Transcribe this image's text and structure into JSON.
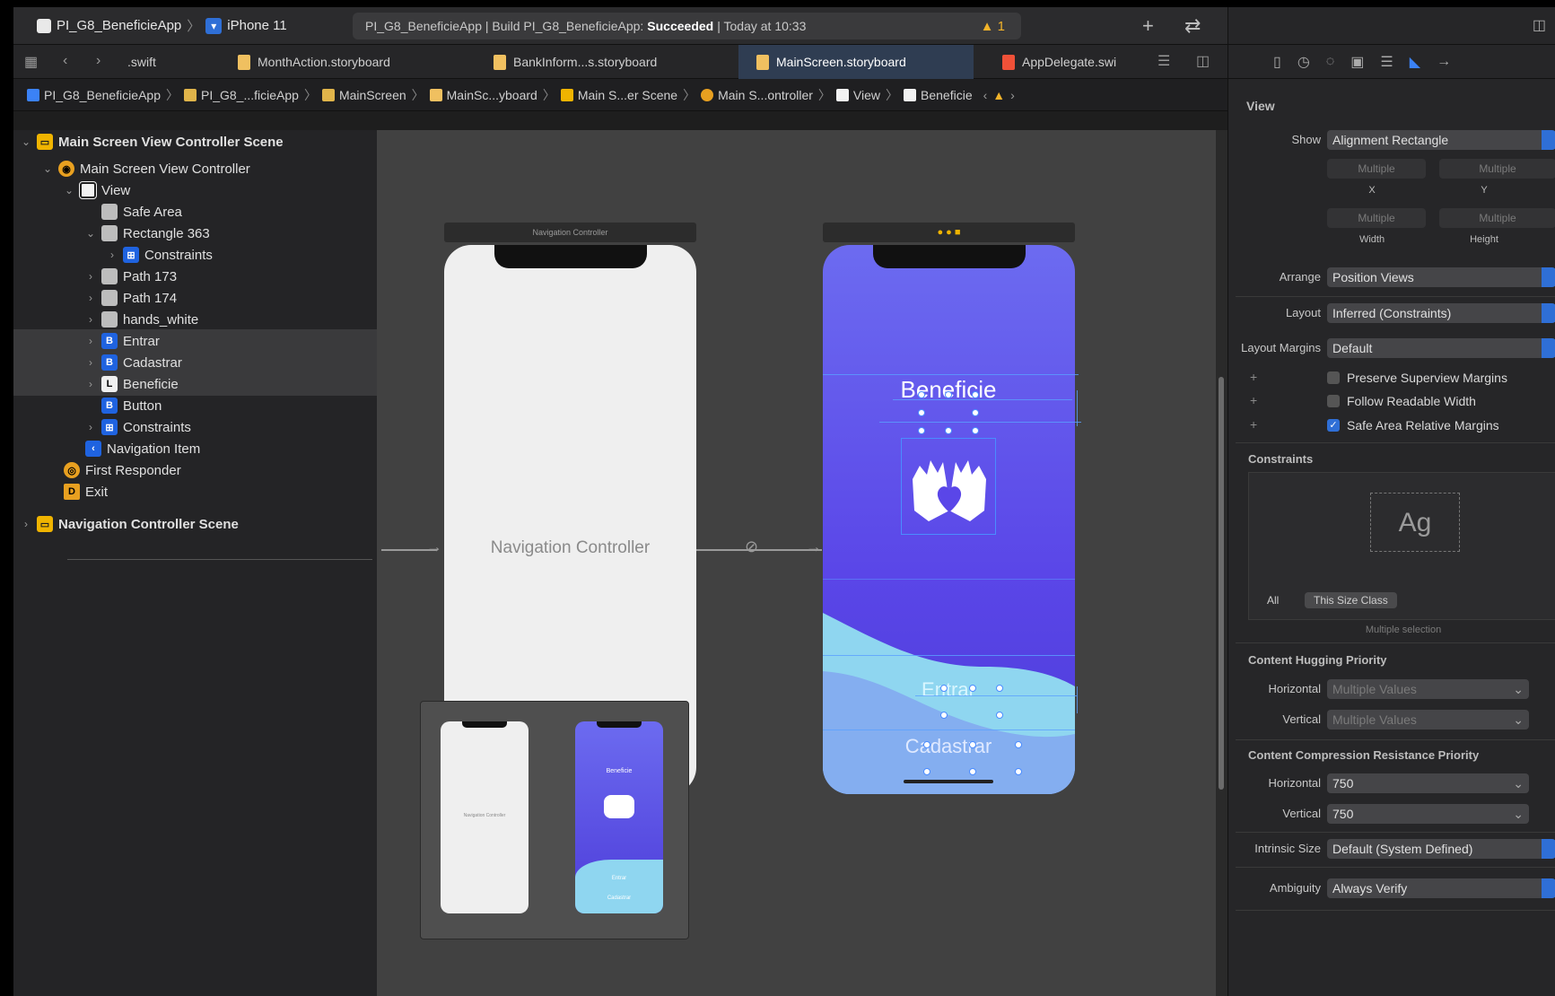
{
  "toolbar": {
    "project": "PI_G8_BeneficieApp",
    "device": "iPhone 11",
    "status_prefix": "PI_G8_BeneficieApp | Build PI_G8_BeneficieApp:",
    "status_result": "Succeeded",
    "status_time": "| Today at 10:33",
    "warning_count": "1"
  },
  "tabs": [
    {
      "label": ".swift"
    },
    {
      "label": "MonthAction.storyboard"
    },
    {
      "label": "BankInform...s.storyboard"
    },
    {
      "label": "MainScreen.storyboard"
    },
    {
      "label": "AppDelegate.swi"
    }
  ],
  "breadcrumb": [
    "PI_G8_BeneficieApp",
    "PI_G8_...ficieApp",
    "MainScreen",
    "MainSc...yboard",
    "Main S...er Scene",
    "Main S...ontroller",
    "View",
    "Beneficie"
  ],
  "outline": {
    "scene1": "Main Screen View Controller Scene",
    "controller": "Main Screen View Controller",
    "view": "View",
    "safe_area": "Safe Area",
    "rect": "Rectangle 363",
    "constraints_inner": "Constraints",
    "path173": "Path 173",
    "path174": "Path 174",
    "hands": "hands_white",
    "entrar": "Entrar",
    "cadastrar": "Cadastrar",
    "beneficie": "Beneficie",
    "button": "Button",
    "constraints": "Constraints",
    "nav_item": "Navigation Item",
    "first_responder": "First Responder",
    "exit": "Exit",
    "scene2": "Navigation Controller Scene"
  },
  "canvas": {
    "nav_scene_title": "Navigation Controller",
    "nav_label": "Navigation Controller",
    "title_text": "Beneficie",
    "entrar_text": "Entrar",
    "cadastrar_text": "Cadastrar",
    "mini_nav_label": "Navigation Controller",
    "mini_title": "Beneficie",
    "mini_entrar": "Entrar",
    "mini_cadastrar": "Cadastrar"
  },
  "inspector": {
    "section_view": "View",
    "show_label": "Show",
    "show_value": "Alignment Rectangle",
    "x_placeholder": "Multiple",
    "y_placeholder": "Multiple",
    "x_label": "X",
    "y_label": "Y",
    "w_placeholder": "Multiple",
    "h_placeholder": "Multiple",
    "w_label": "Width",
    "h_label": "Height",
    "arrange_label": "Arrange",
    "arrange_value": "Position Views",
    "layout_label": "Layout",
    "layout_value": "Inferred (Constraints)",
    "margins_label": "Layout Margins",
    "margins_value": "Default",
    "cb_preserve": "Preserve Superview Margins",
    "cb_follow": "Follow Readable Width",
    "cb_safe": "Safe Area Relative Margins",
    "constraints_title": "Constraints",
    "ag": "Ag",
    "tab_all": "All",
    "tab_this": "This Size Class",
    "multi_selection": "Multiple selection",
    "hugging_title": "Content Hugging Priority",
    "horizontal": "Horizontal",
    "vertical": "Vertical",
    "hug_h": "Multiple Values",
    "hug_v": "Multiple Values",
    "compression_title": "Content Compression Resistance Priority",
    "comp_h": "750",
    "comp_v": "750",
    "intrinsic_label": "Intrinsic Size",
    "intrinsic_value": "Default (System Defined)",
    "ambiguity_label": "Ambiguity",
    "ambiguity_value": "Always Verify"
  }
}
